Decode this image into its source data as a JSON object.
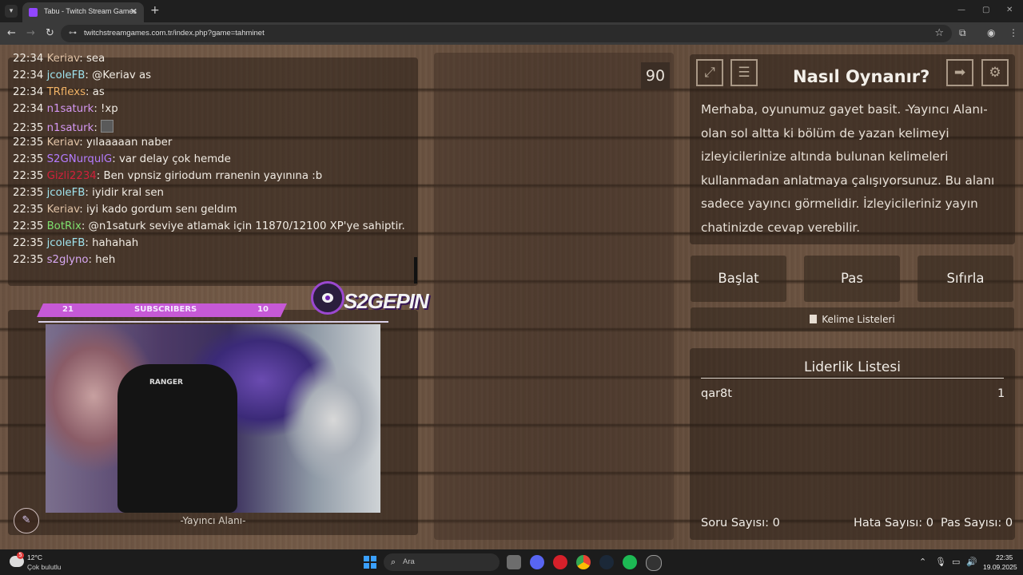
{
  "browser": {
    "tab_title": "Tabu - Twitch Stream Games",
    "url": "twitchstreamgames.com.tr/index.php?game=tahminet",
    "new_tab_symbol": "+",
    "close_symbol": "✕",
    "win_minimize": "—",
    "win_maximize": "▢",
    "win_close": "✕",
    "back": "←",
    "forward": "→",
    "reload": "↻",
    "star": "☆",
    "extensions": "⧉",
    "menu": "⋮"
  },
  "chat": {
    "lines": [
      {
        "time": "22:34",
        "user": "Keriav",
        "msg": ": sea"
      },
      {
        "time": "22:34",
        "user": "jcoleFB",
        "msg": ": @Keriav as"
      },
      {
        "time": "22:34",
        "user": "TRflexs",
        "msg": ": as"
      },
      {
        "time": "22:34",
        "user": "n1saturk",
        "msg": ": !xp"
      },
      {
        "time": "22:35",
        "user": "n1saturk",
        "msg": ": "
      },
      {
        "time": "22:35",
        "user": "Keriav",
        "msg": ": yılaaaaan naber"
      },
      {
        "time": "22:35",
        "user": "S2GNurqulG",
        "msg": ": var delay çok hemde"
      },
      {
        "time": "22:35",
        "user": "Gizli2234",
        "msg": ": Ben vpnsiz giriodum rranenin yayınına :b"
      },
      {
        "time": "22:35",
        "user": "jcoleFB",
        "msg": ": iyidir kral sen"
      },
      {
        "time": "22:35",
        "user": "Keriav",
        "msg": ": iyi kado gordum senı geldım"
      },
      {
        "time": "22:35",
        "user": "BotRix",
        "msg": ": @n1saturk seviye atlamak için 11870/12100 XP'ye sahiptir."
      },
      {
        "time": "22:35",
        "user": "jcoleFB",
        "msg": ": hahahah"
      },
      {
        "time": "22:35",
        "user": "s2glyno",
        "msg": ": heh"
      }
    ]
  },
  "streamer": {
    "sub_left": "21",
    "sub_label": "SUBSCRIBERS",
    "sub_right": "10",
    "logo_text": "S2GEPIN",
    "chair_brand": "RANGER",
    "caption": "-Yayıncı Alanı-",
    "edit_icon": "✎"
  },
  "board": {
    "timer": "90"
  },
  "howto": {
    "title": "Nasıl Oynanır?",
    "text": "Merhaba, oyunumuz gayet basit. -Yayıncı Alanı- olan sol altta ki bölüm de yazan kelimeyi izleyicilerinize altında bulunan kelimeleri kullanmadan anlatmaya çalışıyorsunuz. Bu alanı sadece yayıncı görmelidir. İzleyicileriniz yayın chatinizde cevap verebilir.",
    "fullscreen_icon": "⤢",
    "list_icon": "☰",
    "exit_icon": "➡",
    "settings_icon": "⚙"
  },
  "buttons": {
    "start": "Başlat",
    "pass": "Pas",
    "reset": "Sıfırla",
    "word_lists": "Kelime Listeleri"
  },
  "leaderboard": {
    "title": "Liderlik Listesi",
    "entries": [
      {
        "name": "qar8t",
        "score": "1"
      }
    ],
    "question_count": "Soru Sayısı: 0",
    "error_count": "Hata Sayısı: 0",
    "pass_count": "Pas Sayısı: 0"
  },
  "taskbar": {
    "weather_badge": "5",
    "temp": "12°C",
    "weather": "Çok bulutlu",
    "search_placeholder": "Ara",
    "search_icon": "⌕",
    "tray_chevron": "⌃",
    "tray_mic": "🎙",
    "tray_net": "▭",
    "tray_vol": "🔊",
    "time": "22:35",
    "date": "19.09.2025"
  }
}
